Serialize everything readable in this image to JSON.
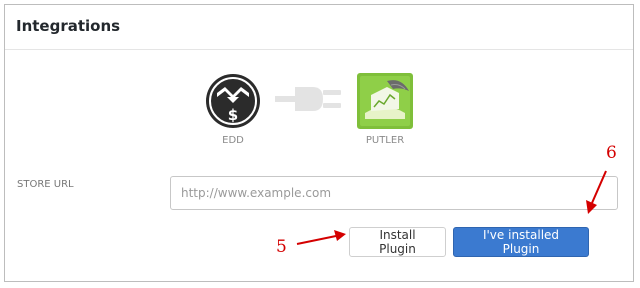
{
  "panel": {
    "title": "Integrations"
  },
  "integrations": {
    "source": {
      "label": "EDD",
      "icon": "edd-icon"
    },
    "connector": {
      "icon": "plug-icon"
    },
    "target": {
      "label": "PUTLER",
      "icon": "putler-icon"
    }
  },
  "store_url": {
    "label": "STORE URL",
    "placeholder": "http://www.example.com",
    "value": ""
  },
  "actions": {
    "install_label": "Install Plugin",
    "installed_label": "I've installed Plugin"
  },
  "annotations": {
    "step_5": "5",
    "step_6": "6",
    "color": "#d40000"
  },
  "colors": {
    "primary_button": "#3b7ad0",
    "border": "#bdbdbd",
    "putler_green": "#7fbf3a"
  }
}
